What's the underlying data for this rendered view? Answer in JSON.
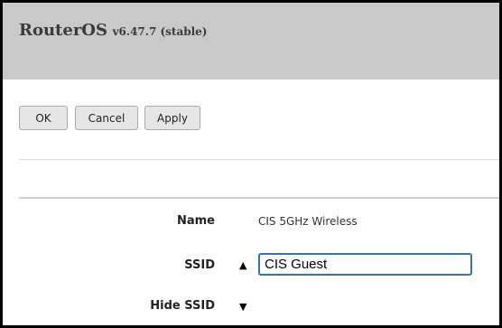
{
  "header": {
    "app_name": "RouterOS",
    "version": "v6.47.7 (stable)"
  },
  "toolbar": {
    "ok_label": "OK",
    "cancel_label": "Cancel",
    "apply_label": "Apply"
  },
  "form": {
    "name_label": "Name",
    "name_value": "CIS 5GHz Wireless",
    "ssid_label": "SSID",
    "ssid_value": "CIS Guest",
    "hide_ssid_label": "Hide SSID"
  },
  "icons": {
    "ssid_toggle": "triangle-up-icon",
    "hide_ssid_toggle": "triangle-down-icon"
  },
  "colors": {
    "header_bg": "#c9c9c9",
    "input_focus_border": "#3a6fc0"
  }
}
